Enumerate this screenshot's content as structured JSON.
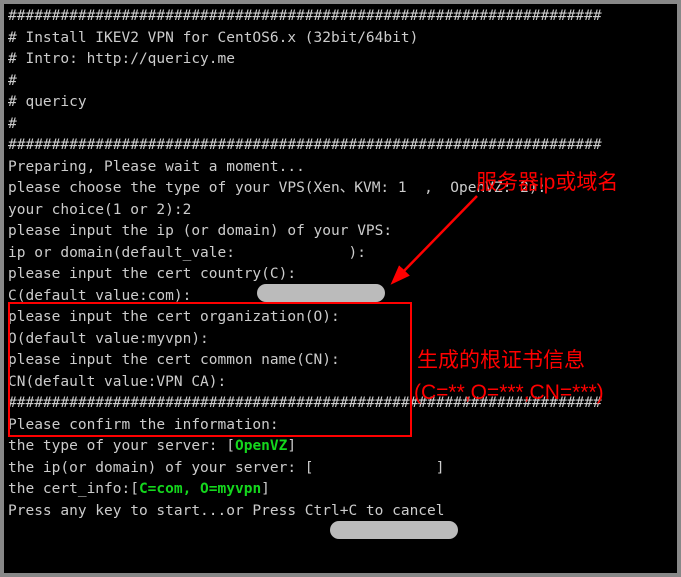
{
  "lines": {
    "l0": "####################################################################",
    "l1": "# Install IKEV2 VPN for CentOS6.x (32bit/64bit)",
    "l2": "# Intro: http://quericy.me",
    "l3": "#",
    "l4": "# quericy",
    "l5": "#",
    "l6": "####################################################################",
    "l7": "",
    "l8": "Preparing, Please wait a moment...",
    "l9": "please choose the type of your VPS(Xen、KVM: 1  ,  OpenVZ: 2):",
    "l10": "your choice(1 or 2):2",
    "l11": "please input the ip (or domain) of your VPS:",
    "l12": "ip or domain(default_vale:             ):",
    "l13": "please input the cert country(C):",
    "l14": "C(default value:com):",
    "l15": "please input the cert organization(O):",
    "l16": "O(default value:myvpn):",
    "l17": "please input the cert common name(CN):",
    "l18": "CN(default value:VPN CA):",
    "l19": "####################################################################",
    "l20": "Please confirm the information:",
    "l21": "",
    "l22a": "the type of your server: [",
    "l22b": "OpenVZ",
    "l22c": "]",
    "l23a": "the ip(or domain) of your server: [",
    "l23b": "              ",
    "l23c": "]",
    "l24a": "the cert_info:[",
    "l24b": "C=com, O=myvpn",
    "l24c": "]",
    "l25": "",
    "l26": "Press any key to start...or Press Ctrl+C to cancel"
  },
  "annotations": {
    "top_label": "服务器ip或域名",
    "cert_label_1": "生成的根证书信息",
    "cert_label_2": "(C=**,O=***,CN=***)"
  }
}
